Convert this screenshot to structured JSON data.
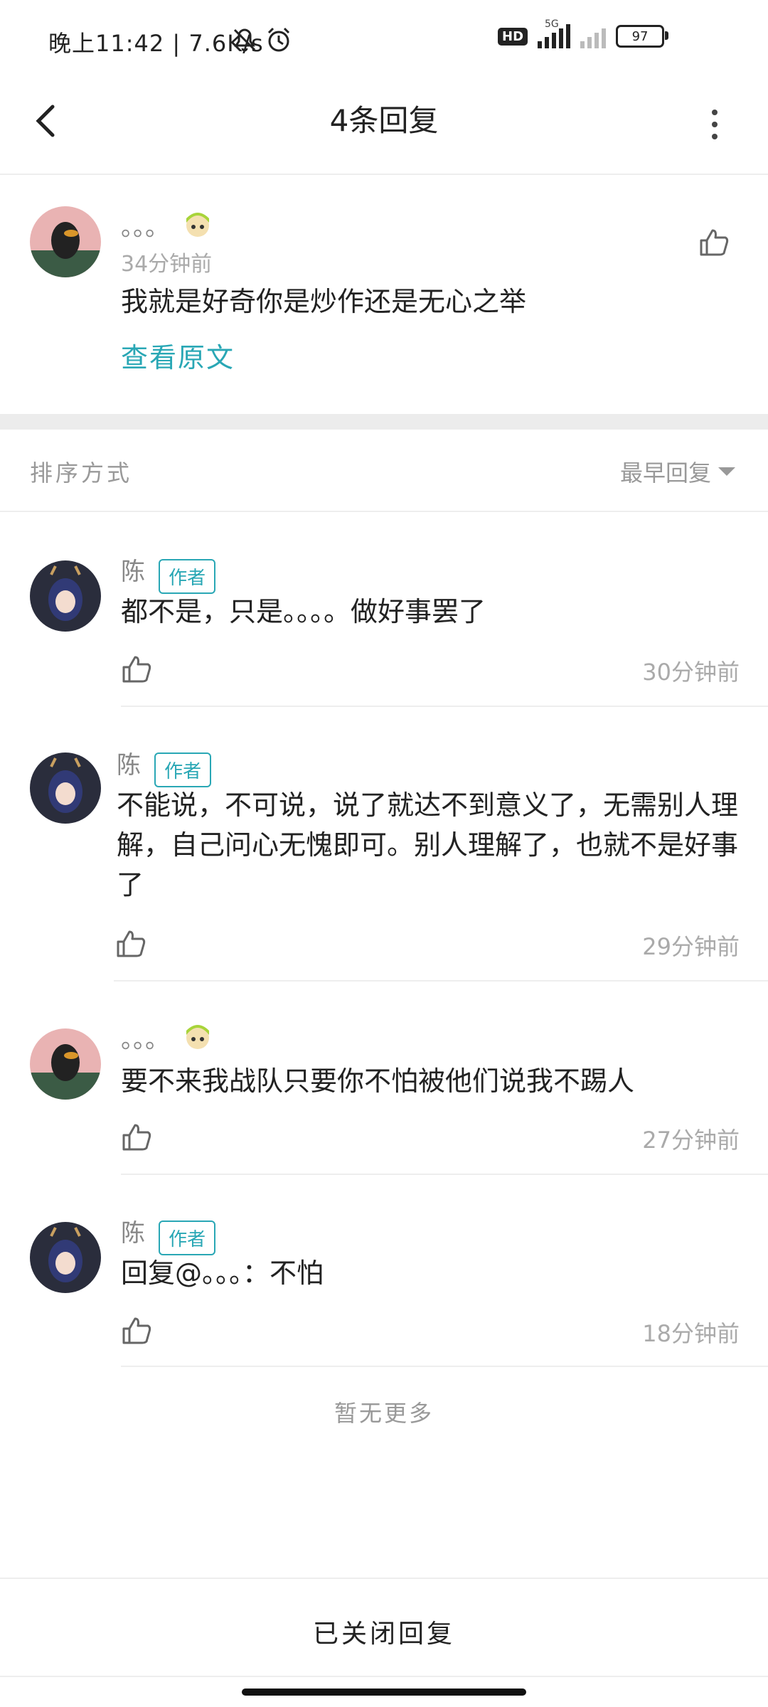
{
  "status_bar": {
    "time_speed": "晚上11:42 | 7.6K/s",
    "signal_label": "5G",
    "hd_label": "HD",
    "battery": "97"
  },
  "header": {
    "title": "4条回复"
  },
  "original": {
    "name": "。。。",
    "time": "34分钟前",
    "text": "我就是好奇你是炒作还是无心之举",
    "view_original": "查看原文"
  },
  "sort": {
    "label": "排序方式",
    "value": "最早回复"
  },
  "replies": [
    {
      "name": "陈",
      "badge": "作者",
      "text": "都不是，只是。。。。做好事罢了",
      "time": "30分钟前"
    },
    {
      "name": "陈",
      "badge": "作者",
      "text": "不能说，不可说，说了就达不到意义了，无需别人理解，自己问心无愧即可。别人理解了，也就不是好事了",
      "time": "29分钟前"
    },
    {
      "name": "。。。",
      "text": "要不来我战队只要你不怕被他们说我不踢人",
      "time": "27分钟前"
    },
    {
      "name": "陈",
      "badge": "作者",
      "text": "回复@。。。：不怕",
      "time": "18分钟前"
    }
  ],
  "footer": {
    "no_more": "暂无更多",
    "closed": "已关闭回复"
  },
  "colors": {
    "accent": "#29a7b5",
    "muted": "#999999"
  }
}
